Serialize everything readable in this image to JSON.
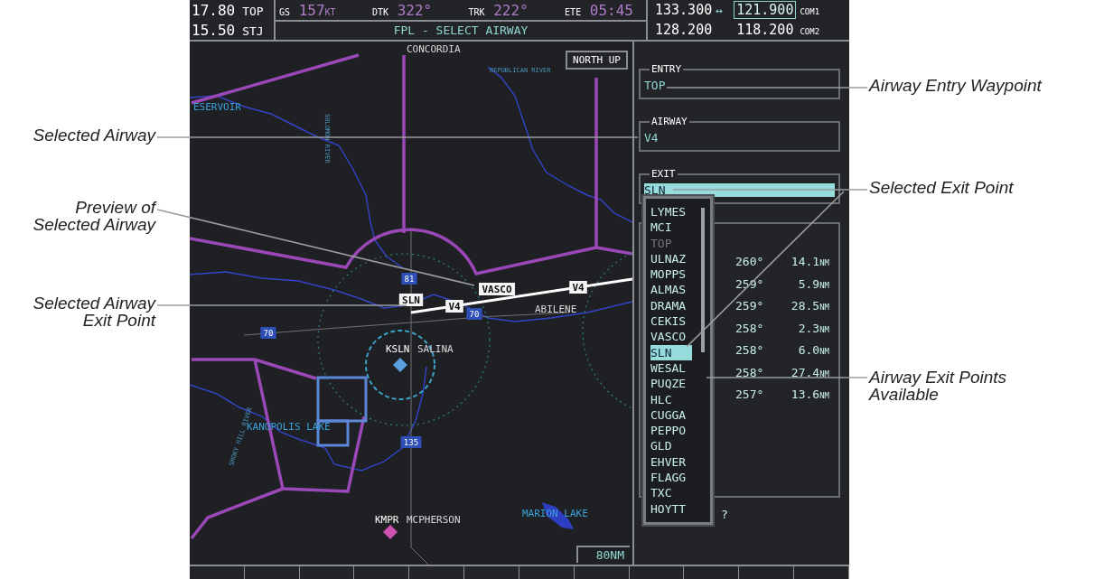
{
  "nav": [
    {
      "frequency": "17.80",
      "ident": "TOP"
    },
    {
      "frequency": "15.50",
      "ident": "STJ"
    }
  ],
  "data_bar": [
    {
      "label": "GS",
      "value": "157",
      "unit": "KT"
    },
    {
      "label": "DTK",
      "value": "322°"
    },
    {
      "label": "TRK",
      "value": "222°"
    },
    {
      "label": "ETE",
      "value": "05:45"
    }
  ],
  "page_title": "FPL - SELECT AIRWAY",
  "com": [
    {
      "active": "133.300",
      "swap": "↔",
      "standby": "121.900",
      "selected": true,
      "label": "COM1"
    },
    {
      "active": "128.200",
      "standby": "118.200",
      "selected": false,
      "label": "COM2"
    }
  ],
  "map": {
    "orientation": "NORTH UP",
    "range": "80NM",
    "labels": [
      {
        "text": "CONCORDIA",
        "kind": "place"
      },
      {
        "text": "REPUBLICAN RIVER",
        "kind": "river"
      },
      {
        "text": "ESERVOIR",
        "kind": "water"
      },
      {
        "text": "SOLOMON RIVER",
        "kind": "river"
      },
      {
        "text": "VASCO",
        "kind": "waypoint"
      },
      {
        "text": "V4",
        "kind": "airway"
      },
      {
        "text": "SLN",
        "kind": "waypoint"
      },
      {
        "text": "V4",
        "kind": "airway"
      },
      {
        "text": "ABILENE",
        "kind": "place"
      },
      {
        "text": "81",
        "kind": "highway"
      },
      {
        "text": "70",
        "kind": "highway"
      },
      {
        "text": "70",
        "kind": "highway"
      },
      {
        "text": "KSLN",
        "kind": "airport"
      },
      {
        "text": "SALINA",
        "kind": "place"
      },
      {
        "text": "KANOPOLIS LAKE",
        "kind": "water"
      },
      {
        "text": "SMOKY HILL RIVER",
        "kind": "river"
      },
      {
        "text": "135",
        "kind": "highway"
      },
      {
        "text": "KMPR",
        "kind": "airport"
      },
      {
        "text": "MCPHERSON",
        "kind": "place"
      },
      {
        "text": "MARION LAKE",
        "kind": "water"
      }
    ]
  },
  "fields": [
    {
      "label": "ENTRY",
      "value": "TOP",
      "selected": false
    },
    {
      "label": "AIRWAY",
      "value": "V4",
      "selected": false
    },
    {
      "label": "EXIT",
      "value": "SLN",
      "selected": true
    }
  ],
  "exit_points": [
    {
      "name": "LYMES",
      "selected": false,
      "disabled": false
    },
    {
      "name": "MCI",
      "selected": false,
      "disabled": false
    },
    {
      "name": "TOP",
      "selected": false,
      "disabled": true
    },
    {
      "name": "ULNAZ",
      "selected": false,
      "disabled": false
    },
    {
      "name": "MOPPS",
      "selected": false,
      "disabled": false
    },
    {
      "name": "ALMAS",
      "selected": false,
      "disabled": false
    },
    {
      "name": "DRAMA",
      "selected": false,
      "disabled": false
    },
    {
      "name": "CEKIS",
      "selected": false,
      "disabled": false
    },
    {
      "name": "VASCO",
      "selected": false,
      "disabled": false
    },
    {
      "name": "SLN",
      "selected": true,
      "disabled": false
    },
    {
      "name": "WESAL",
      "selected": false,
      "disabled": false
    },
    {
      "name": "PUQZE",
      "selected": false,
      "disabled": false
    },
    {
      "name": "HLC",
      "selected": false,
      "disabled": false
    },
    {
      "name": "CUGGA",
      "selected": false,
      "disabled": false
    },
    {
      "name": "PEPPO",
      "selected": false,
      "disabled": false
    },
    {
      "name": "GLD",
      "selected": false,
      "disabled": false
    },
    {
      "name": "EHVER",
      "selected": false,
      "disabled": false
    },
    {
      "name": "FLAGG",
      "selected": false,
      "disabled": false
    },
    {
      "name": "TXC",
      "selected": false,
      "disabled": false
    },
    {
      "name": "HOYTT",
      "selected": false,
      "disabled": false
    }
  ],
  "legs": [
    {
      "course": "260°",
      "distance": "14.1",
      "unit": "NM"
    },
    {
      "course": "259°",
      "distance": "5.9",
      "unit": "NM"
    },
    {
      "course": "259°",
      "distance": "28.5",
      "unit": "NM"
    },
    {
      "course": "258°",
      "distance": "2.3",
      "unit": "NM"
    },
    {
      "course": "258°",
      "distance": "6.0",
      "unit": "NM"
    },
    {
      "course": "258°",
      "distance": "27.4",
      "unit": "NM"
    },
    {
      "course": "257°",
      "distance": "13.6",
      "unit": "NM"
    }
  ],
  "trailing_mark": "?",
  "callouts": [
    "Airway Entry Waypoint",
    "Selected Airway",
    "Selected Exit Point",
    "Preview of Selected Airway",
    "Selected Airway Exit Point",
    "Airway Exit Points Available"
  ]
}
